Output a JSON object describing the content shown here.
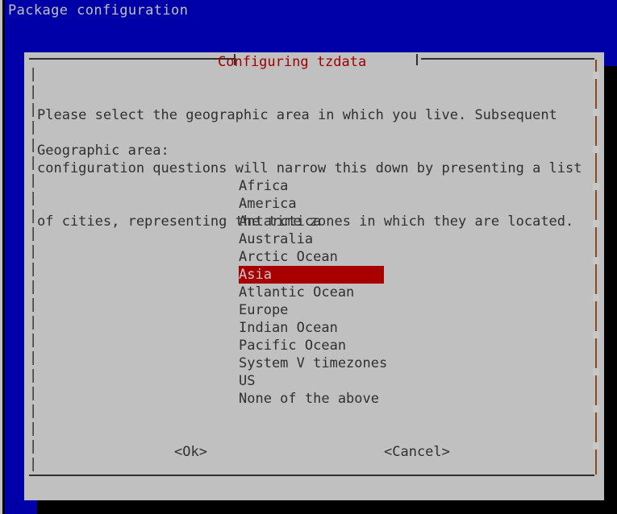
{
  "terminal": {
    "backtitle": "Package configuration",
    "background_color": "#0000a8",
    "text_color": "#c0c0c0"
  },
  "dialog": {
    "title": "Configuring tzdata",
    "title_color": "#a00000",
    "background_color": "#c0c0c0",
    "prompt_lines": [
      "Please select the geographic area in which you live. Subsequent",
      "configuration questions will narrow this down by presenting a list",
      "of cities, representing the time zones in which they are located."
    ],
    "field_label": "Geographic area:",
    "menu": {
      "selected_index": 5,
      "selected_color": "#a80000",
      "items": [
        {
          "label": "Africa"
        },
        {
          "label": "America"
        },
        {
          "label": "Antarctica"
        },
        {
          "label": "Australia"
        },
        {
          "label": "Arctic Ocean"
        },
        {
          "label": "Asia"
        },
        {
          "label": "Atlantic Ocean"
        },
        {
          "label": "Europe"
        },
        {
          "label": "Indian Ocean"
        },
        {
          "label": "Pacific Ocean"
        },
        {
          "label": "System V timezones"
        },
        {
          "label": "US"
        },
        {
          "label": "None of the above"
        }
      ]
    },
    "buttons": {
      "ok": "<Ok>",
      "cancel": "<Cancel>"
    },
    "frame": {
      "left_bars": "|\n|\n|\n|\n|\n|\n|\n|\n|\n|\n|\n|\n|\n|\n|\n|\n|\n|\n|\n|\n|\n|\n|"
    }
  }
}
